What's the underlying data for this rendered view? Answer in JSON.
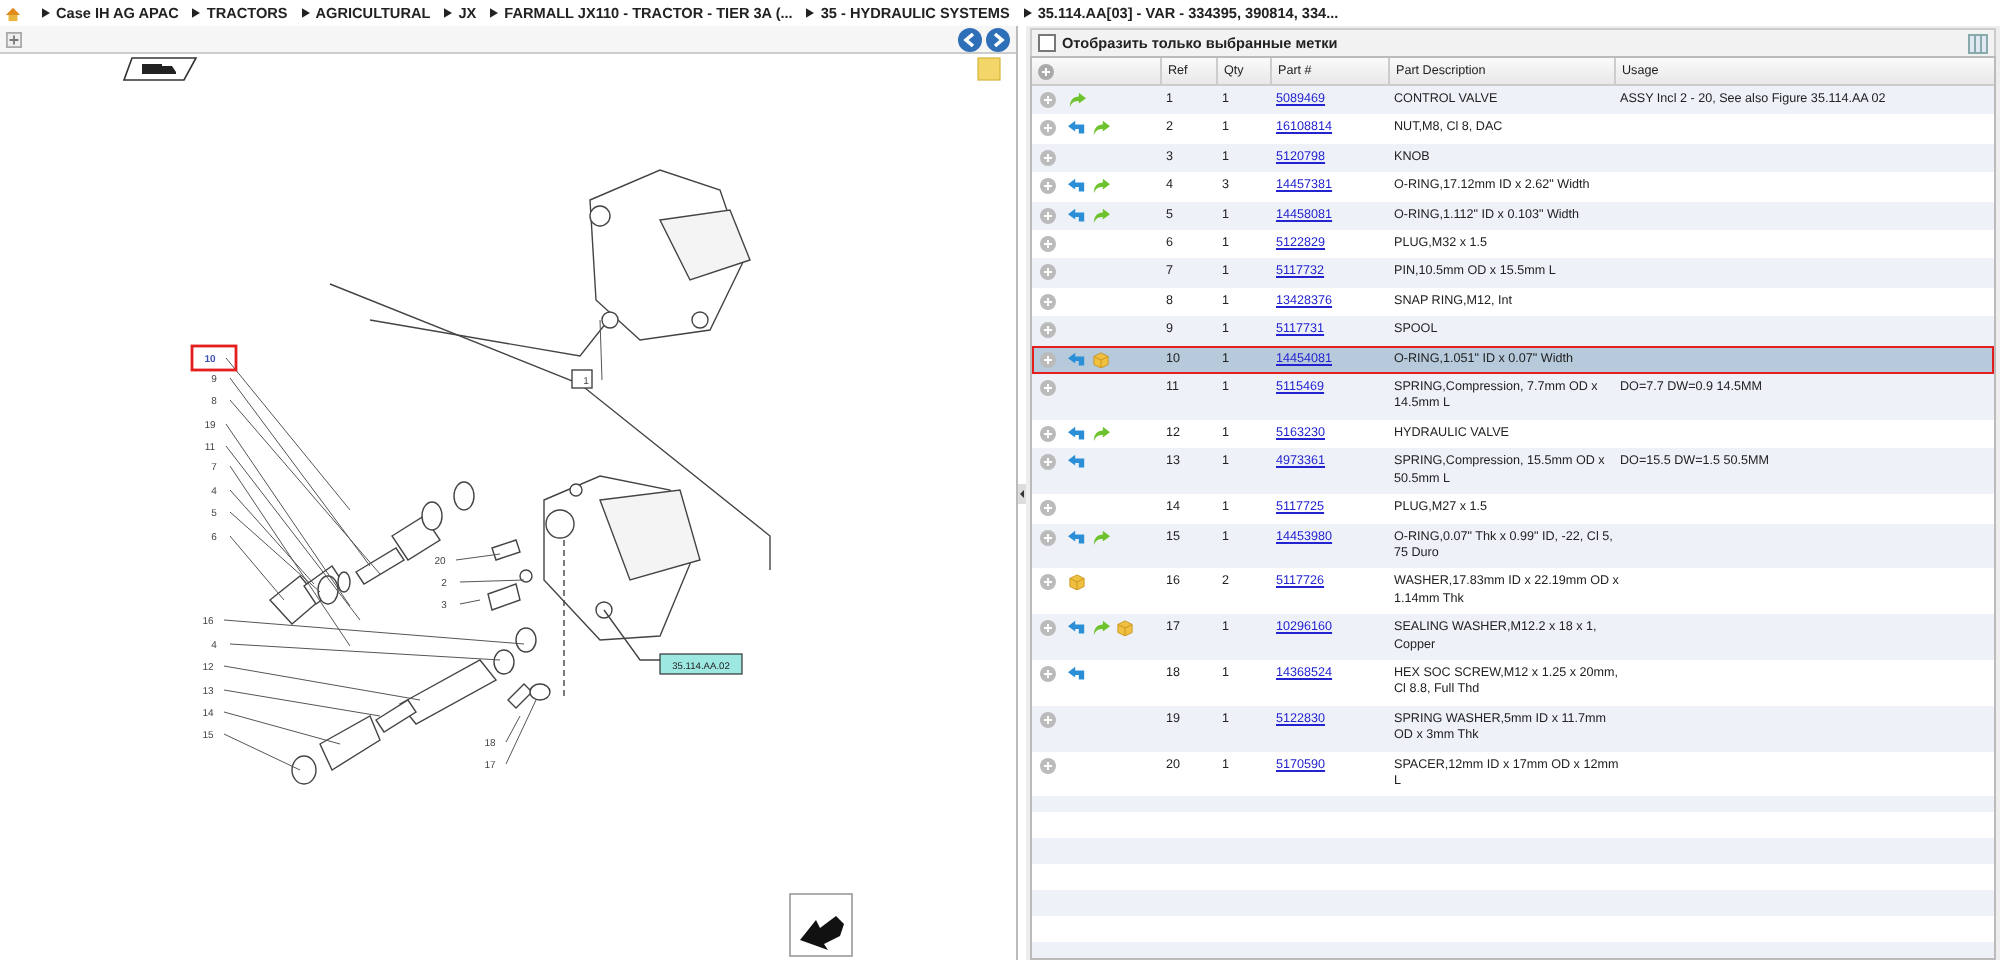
{
  "breadcrumb": [
    "Case IH AG APAC",
    "TRACTORS",
    "AGRICULTURAL",
    "JX",
    "FARMALL JX110 - TRACTOR - TIER 3A (...",
    "35 - HYDRAULIC SYSTEMS",
    "35.114.AA[03] - VAR - 334395, 390814, 334..."
  ],
  "diagram": {
    "callouts": [
      {
        "label": "10",
        "selected": true
      },
      {
        "label": "9",
        "selected": false
      },
      {
        "label": "8",
        "selected": false
      },
      {
        "label": "19",
        "selected": false
      },
      {
        "label": "11",
        "selected": false
      },
      {
        "label": "7",
        "selected": false
      },
      {
        "label": "4",
        "selected": false
      },
      {
        "label": "5",
        "selected": false
      },
      {
        "label": "6",
        "selected": false
      },
      {
        "label": "16",
        "selected": false
      },
      {
        "label": "4",
        "selected": false
      },
      {
        "label": "12",
        "selected": false
      },
      {
        "label": "13",
        "selected": false
      },
      {
        "label": "14",
        "selected": false
      },
      {
        "label": "15",
        "selected": false
      },
      {
        "label": "20",
        "selected": false
      },
      {
        "label": "2",
        "selected": false
      },
      {
        "label": "3",
        "selected": false
      },
      {
        "label": "18",
        "selected": false
      },
      {
        "label": "17",
        "selected": false
      },
      {
        "label": "1",
        "selected": false
      }
    ],
    "reference_tag": "35.114.AA.02"
  },
  "filter": {
    "label": "Отобразить только выбранные метки",
    "checked": false
  },
  "table": {
    "columns": [
      "Ref",
      "Qty",
      "Part #",
      "Part Description",
      "Usage"
    ],
    "rows": [
      {
        "ref": "1",
        "qty": "1",
        "part": "5089469",
        "description": "CONTROL VALVE",
        "usage": "ASSY Incl 2 - 20, See also Figure 35.114.AA 02",
        "back": false,
        "forward": true,
        "box": false,
        "selected": false
      },
      {
        "ref": "2",
        "qty": "1",
        "part": "16108814",
        "description": "NUT,M8, Cl 8, DAC",
        "back": true,
        "forward": true,
        "box": false,
        "selected": false
      },
      {
        "ref": "3",
        "qty": "1",
        "part": "5120798",
        "description": "KNOB",
        "back": false,
        "forward": false,
        "box": false,
        "selected": false
      },
      {
        "ref": "4",
        "qty": "3",
        "part": "14457381",
        "description": "O-RING,17.12mm ID x 2.62\" Width",
        "back": true,
        "forward": true,
        "box": false,
        "selected": false
      },
      {
        "ref": "5",
        "qty": "1",
        "part": "14458081",
        "description": "O-RING,1.112\" ID x 0.103\" Width",
        "back": true,
        "forward": true,
        "box": false,
        "selected": false
      },
      {
        "ref": "6",
        "qty": "1",
        "part": "5122829",
        "description": "PLUG,M32 x 1.5",
        "back": false,
        "forward": false,
        "box": false,
        "selected": false
      },
      {
        "ref": "7",
        "qty": "1",
        "part": "5117732",
        "description": "PIN,10.5mm OD x 15.5mm L",
        "back": false,
        "forward": false,
        "box": false,
        "selected": false
      },
      {
        "ref": "8",
        "qty": "1",
        "part": "13428376",
        "description": "SNAP RING,M12, Int",
        "back": false,
        "forward": false,
        "box": false,
        "selected": false
      },
      {
        "ref": "9",
        "qty": "1",
        "part": "5117731",
        "description": "SPOOL",
        "back": false,
        "forward": false,
        "box": false,
        "selected": false
      },
      {
        "ref": "10",
        "qty": "1",
        "part": "14454081",
        "description": "O-RING,1.051\" ID x 0.07\" Width",
        "back": true,
        "forward": false,
        "box": true,
        "selected": true
      },
      {
        "ref": "11",
        "qty": "1",
        "part": "5115469",
        "description": "SPRING,Compression, 7.7mm OD x 14.5mm L",
        "usage": "DO=7.7 DW=0.9 14.5MM",
        "back": false,
        "forward": false,
        "box": false,
        "selected": false
      },
      {
        "ref": "12",
        "qty": "1",
        "part": "5163230",
        "description": "HYDRAULIC VALVE",
        "back": true,
        "forward": true,
        "box": false,
        "selected": false
      },
      {
        "ref": "13",
        "qty": "1",
        "part": "4973361",
        "description": "SPRING,Compression, 15.5mm OD x 50.5mm L",
        "usage": "DO=15.5 DW=1.5 50.5MM",
        "back": true,
        "forward": false,
        "box": false,
        "selected": false
      },
      {
        "ref": "14",
        "qty": "1",
        "part": "5117725",
        "description": "PLUG,M27 x 1.5",
        "back": false,
        "forward": false,
        "box": false,
        "selected": false
      },
      {
        "ref": "15",
        "qty": "1",
        "part": "14453980",
        "description": "O-RING,0.07\" Thk x 0.99\" ID, -22, Cl 5, 75 Duro",
        "back": true,
        "forward": true,
        "box": false,
        "selected": false
      },
      {
        "ref": "16",
        "qty": "2",
        "part": "5117726",
        "description": "WASHER,17.83mm ID x 22.19mm OD x 1.14mm Thk",
        "back": false,
        "forward": false,
        "box": true,
        "selected": false
      },
      {
        "ref": "17",
        "qty": "1",
        "part": "10296160",
        "description": "SEALING WASHER,M12.2 x 18 x 1, Copper",
        "back": true,
        "forward": true,
        "box": true,
        "selected": false
      },
      {
        "ref": "18",
        "qty": "1",
        "part": "14368524",
        "description": "HEX SOC SCREW,M12 x 1.25 x 20mm, Cl 8.8, Full Thd",
        "back": true,
        "forward": false,
        "box": false,
        "selected": false
      },
      {
        "ref": "19",
        "qty": "1",
        "part": "5122830",
        "description": "SPRING WASHER,5mm ID x 11.7mm OD x 3mm Thk",
        "back": false,
        "forward": false,
        "box": false,
        "selected": false
      },
      {
        "ref": "20",
        "qty": "1",
        "part": "5170590",
        "description": "SPACER,12mm ID x 17mm OD x 12mm L",
        "back": false,
        "forward": false,
        "box": false,
        "selected": false
      }
    ]
  }
}
